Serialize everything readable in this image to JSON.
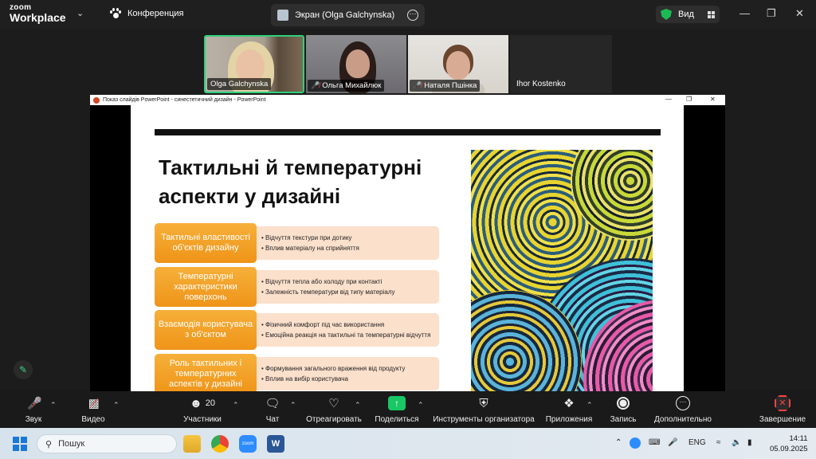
{
  "zoom": {
    "logo_line1": "zoom",
    "logo_line2": "Workplace",
    "meeting_label": "Конференция",
    "screen_tab_label": "Экран (Olga Galchynska)",
    "view_label": "Вид",
    "shield_color": "#1db954"
  },
  "participants": [
    {
      "name": "Olga Galchynska",
      "muted": false,
      "active": true
    },
    {
      "name": "Ольга Михайлюк",
      "muted": true,
      "active": false
    },
    {
      "name": "Наталя Пшінка",
      "muted": true,
      "active": false
    },
    {
      "name": "Ihor Kostenko",
      "muted": false,
      "active": false
    }
  ],
  "ppt": {
    "window_title": "Показ слайдів PowerPoint  -  синестетичний дизайн - PowerPoint",
    "slide_title": "Тактильні й температурні аспекти у дизайні",
    "rows": [
      {
        "label": "Тактильні властивості об'єктів дизайну",
        "bullets": [
          "• Відчуття текстури при дотику",
          "• Вплив матеріалу на сприйняття"
        ]
      },
      {
        "label": "Температурні характеристики поверхонь",
        "bullets": [
          "• Відчуття тепла або холоду при контакті",
          "• Залежність температури від типу матеріалу"
        ]
      },
      {
        "label": "Взаємодія користувача з об'єктом",
        "bullets": [
          "• Фізичний комфорт під час використання",
          "• Емоційна реакція на тактильні та температурні відчуття"
        ]
      },
      {
        "label": "Роль тактильних і температурних аспектів у дизайні",
        "bullets": [
          "• Формування загального враження від продукту",
          "• Вплив на вибір користувача"
        ]
      }
    ],
    "accent_color": "#f0a02a",
    "desc_bg": "#fbe0cc"
  },
  "toolbar": {
    "audio": "Звук",
    "video": "Видео",
    "participants": "Участники",
    "participants_count": "20",
    "chat": "Чат",
    "react": "Отреагировать",
    "share": "Поделиться",
    "host_tools": "Инструменты организатора",
    "apps": "Приложения",
    "record": "Запись",
    "more": "Дополнительно",
    "end": "Завершение"
  },
  "taskbar": {
    "search_placeholder": "Пошук",
    "lang": "ENG",
    "time": "14:11",
    "date": "05.09.2025"
  }
}
